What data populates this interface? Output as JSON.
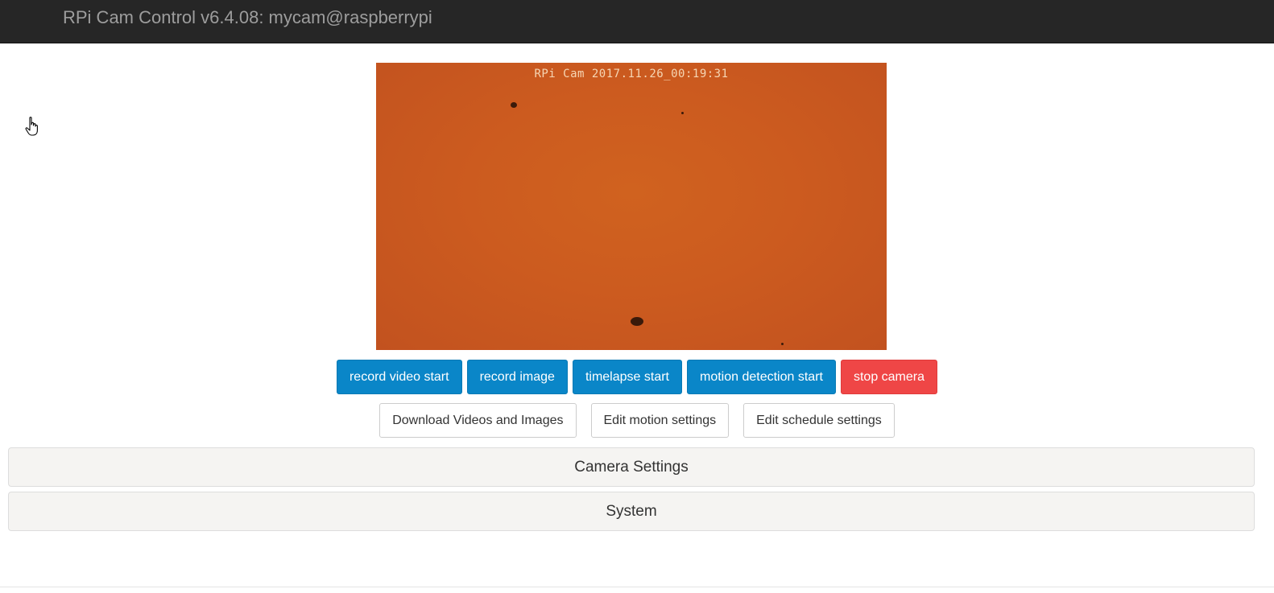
{
  "app": {
    "title": "RPi Cam Control v6.4.08: mycam@raspberrypi"
  },
  "preview": {
    "overlay_text": "RPi Cam 2017.11.26_00:19:31"
  },
  "controls": {
    "record_video": "record video start",
    "record_image": "record image",
    "timelapse": "timelapse start",
    "motion_detection": "motion detection start",
    "stop_camera": "stop camera"
  },
  "links": {
    "download": "Download Videos and Images",
    "edit_motion": "Edit motion settings",
    "edit_schedule": "Edit schedule settings"
  },
  "panels": {
    "camera_settings": "Camera Settings",
    "system": "System"
  },
  "colors": {
    "navbar": "#262626",
    "primary": "#0a86c8",
    "danger": "#ef4646",
    "preview": "#cc5b1f"
  },
  "icons": {
    "cursor": "hand-pointer-icon"
  }
}
